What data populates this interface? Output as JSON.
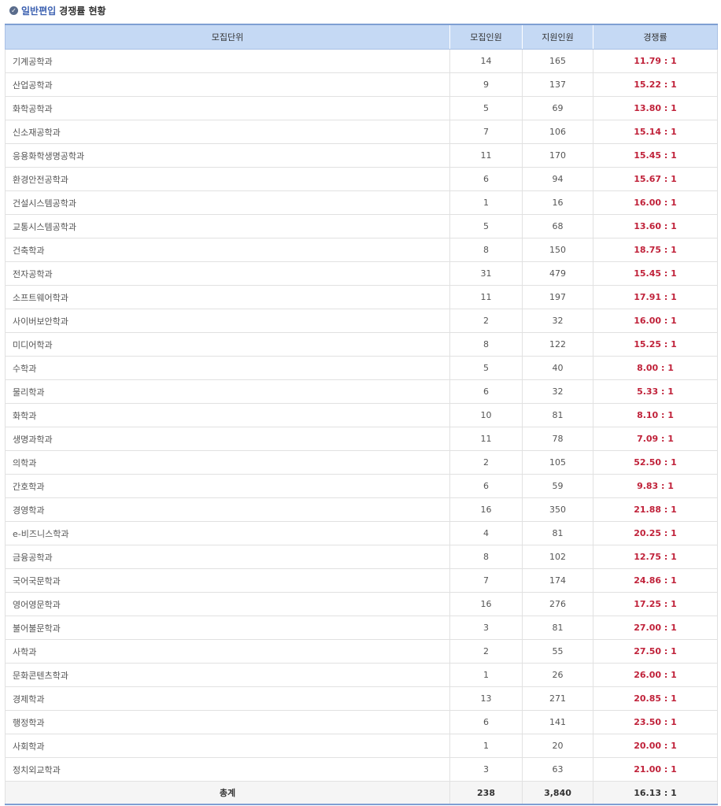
{
  "header": {
    "icon": "check-circle-icon",
    "title_blue": "일반편입",
    "title_dark": "경쟁률 현황"
  },
  "columns": [
    "모집단위",
    "모집인원",
    "지원인원",
    "경쟁률"
  ],
  "rows": [
    {
      "unit": "기계공학과",
      "quota": "14",
      "applicants": "165",
      "ratio": "11.79 : 1"
    },
    {
      "unit": "산업공학과",
      "quota": "9",
      "applicants": "137",
      "ratio": "15.22 : 1"
    },
    {
      "unit": "화학공학과",
      "quota": "5",
      "applicants": "69",
      "ratio": "13.80 : 1"
    },
    {
      "unit": "신소재공학과",
      "quota": "7",
      "applicants": "106",
      "ratio": "15.14 : 1"
    },
    {
      "unit": "응용화학생명공학과",
      "quota": "11",
      "applicants": "170",
      "ratio": "15.45 : 1"
    },
    {
      "unit": "환경안전공학과",
      "quota": "6",
      "applicants": "94",
      "ratio": "15.67 : 1"
    },
    {
      "unit": "건설시스템공학과",
      "quota": "1",
      "applicants": "16",
      "ratio": "16.00 : 1"
    },
    {
      "unit": "교통시스템공학과",
      "quota": "5",
      "applicants": "68",
      "ratio": "13.60 : 1"
    },
    {
      "unit": "건축학과",
      "quota": "8",
      "applicants": "150",
      "ratio": "18.75 : 1"
    },
    {
      "unit": "전자공학과",
      "quota": "31",
      "applicants": "479",
      "ratio": "15.45 : 1"
    },
    {
      "unit": "소프트웨어학과",
      "quota": "11",
      "applicants": "197",
      "ratio": "17.91 : 1"
    },
    {
      "unit": "사이버보안학과",
      "quota": "2",
      "applicants": "32",
      "ratio": "16.00 : 1"
    },
    {
      "unit": "미디어학과",
      "quota": "8",
      "applicants": "122",
      "ratio": "15.25 : 1"
    },
    {
      "unit": "수학과",
      "quota": "5",
      "applicants": "40",
      "ratio": "8.00 : 1"
    },
    {
      "unit": "물리학과",
      "quota": "6",
      "applicants": "32",
      "ratio": "5.33 : 1"
    },
    {
      "unit": "화학과",
      "quota": "10",
      "applicants": "81",
      "ratio": "8.10 : 1"
    },
    {
      "unit": "생명과학과",
      "quota": "11",
      "applicants": "78",
      "ratio": "7.09 : 1"
    },
    {
      "unit": "의학과",
      "quota": "2",
      "applicants": "105",
      "ratio": "52.50 : 1"
    },
    {
      "unit": "간호학과",
      "quota": "6",
      "applicants": "59",
      "ratio": "9.83 : 1"
    },
    {
      "unit": "경영학과",
      "quota": "16",
      "applicants": "350",
      "ratio": "21.88 : 1"
    },
    {
      "unit": "e-비즈니스학과",
      "quota": "4",
      "applicants": "81",
      "ratio": "20.25 : 1"
    },
    {
      "unit": "금융공학과",
      "quota": "8",
      "applicants": "102",
      "ratio": "12.75 : 1"
    },
    {
      "unit": "국어국문학과",
      "quota": "7",
      "applicants": "174",
      "ratio": "24.86 : 1"
    },
    {
      "unit": "영어영문학과",
      "quota": "16",
      "applicants": "276",
      "ratio": "17.25 : 1"
    },
    {
      "unit": "불어불문학과",
      "quota": "3",
      "applicants": "81",
      "ratio": "27.00 : 1"
    },
    {
      "unit": "사학과",
      "quota": "2",
      "applicants": "55",
      "ratio": "27.50 : 1"
    },
    {
      "unit": "문화콘텐츠학과",
      "quota": "1",
      "applicants": "26",
      "ratio": "26.00 : 1"
    },
    {
      "unit": "경제학과",
      "quota": "13",
      "applicants": "271",
      "ratio": "20.85 : 1"
    },
    {
      "unit": "행정학과",
      "quota": "6",
      "applicants": "141",
      "ratio": "23.50 : 1"
    },
    {
      "unit": "사회학과",
      "quota": "1",
      "applicants": "20",
      "ratio": "20.00 : 1"
    },
    {
      "unit": "정치외교학과",
      "quota": "3",
      "applicants": "63",
      "ratio": "21.00 : 1"
    }
  ],
  "total": {
    "label": "총계",
    "quota": "238",
    "applicants": "3,840",
    "ratio": "16.13 : 1"
  },
  "colors": {
    "header_bg": "#c5d9f4",
    "ratio_text": "#c0223a",
    "title_blue": "#3a5fb0"
  }
}
